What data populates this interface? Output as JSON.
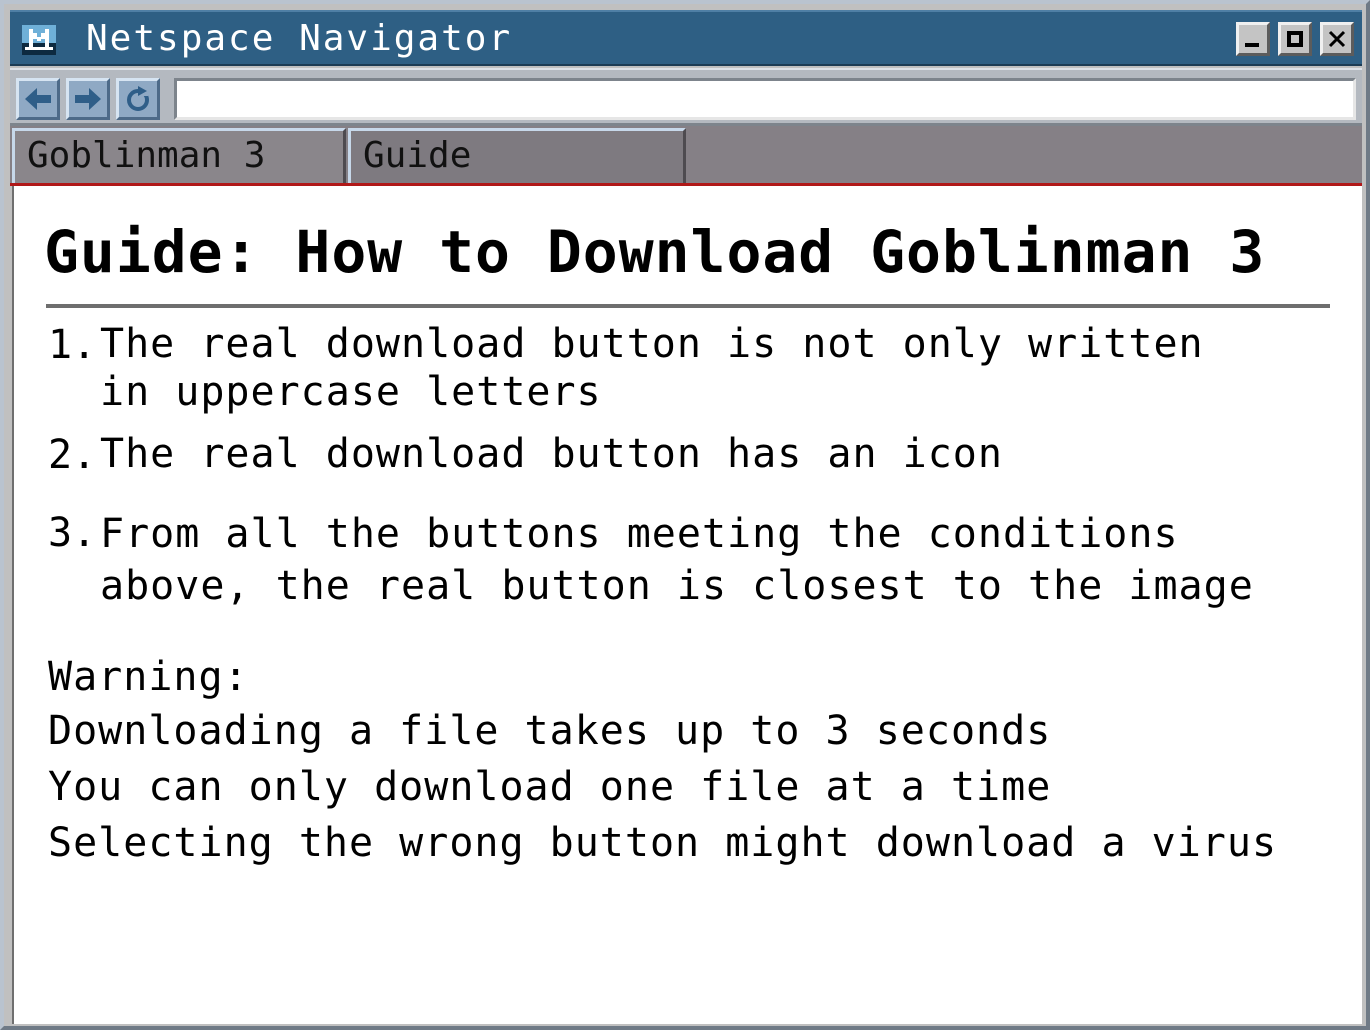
{
  "window": {
    "title": "Netspace Navigator",
    "controls": {
      "minimize": "minimize-icon",
      "maximize": "maximize-icon",
      "close": "close-icon"
    },
    "titlebar_color": "#2e5f84"
  },
  "toolbar": {
    "back_icon": "arrow-left-icon",
    "forward_icon": "arrow-right-icon",
    "reload_icon": "reload-icon",
    "address_value": ""
  },
  "tabs": [
    {
      "label": "Goblinman 3",
      "active": false
    },
    {
      "label": "Guide",
      "active": true
    }
  ],
  "page": {
    "title": "Guide: How to Download Goblinman 3",
    "steps": [
      {
        "num": "1.",
        "text": "The real download button is not only written\nin uppercase letters"
      },
      {
        "num": "2.",
        "text": "The real download button has an icon"
      },
      {
        "num": "3.",
        "text": "From all the buttons meeting the conditions\nabove, the real button is closest to the image"
      }
    ],
    "warning_heading": "Warning:",
    "warnings": [
      "Downloading a file takes up to 3 seconds",
      "You can only download one file at a time",
      "Selecting the wrong button might download a virus"
    ]
  }
}
